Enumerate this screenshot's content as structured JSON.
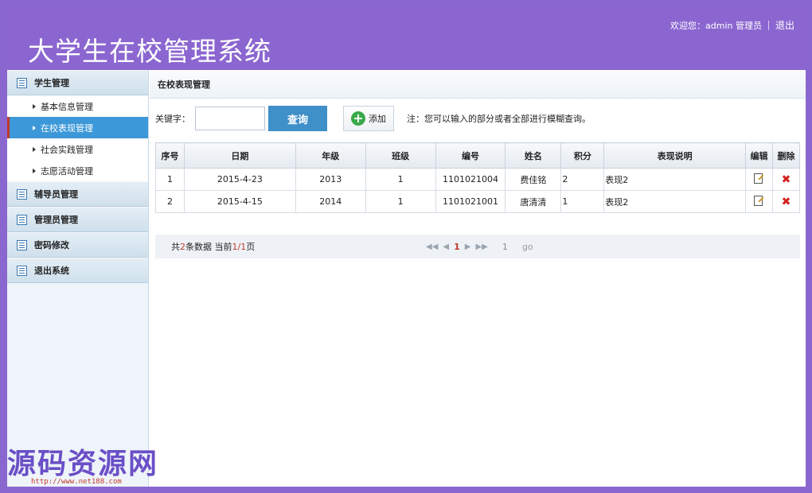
{
  "header": {
    "app_title": "大学生在校管理系统",
    "welcome": "欢迎您：admin 管理员",
    "logout": "退出"
  },
  "sidebar": {
    "groups": [
      {
        "label": "学生管理",
        "items": [
          {
            "label": "基本信息管理"
          },
          {
            "label": "在校表现管理",
            "active": true
          },
          {
            "label": "社会实践管理"
          },
          {
            "label": "志愿活动管理"
          }
        ]
      },
      {
        "label": "辅导员管理"
      },
      {
        "label": "管理员管理"
      },
      {
        "label": "密码修改"
      },
      {
        "label": "退出系统"
      }
    ]
  },
  "main": {
    "breadcrumb": "在校表现管理",
    "search": {
      "label": "关键字：",
      "value": "",
      "query_button": "查询",
      "add_button": "添加",
      "hint": "注：您可以输入的部分或者全部进行模糊查询。"
    },
    "table": {
      "headers": [
        "序号",
        "日期",
        "年级",
        "班级",
        "编号",
        "姓名",
        "积分",
        "表现说明",
        "编辑",
        "删除"
      ],
      "rows": [
        [
          "1",
          "2015-4-23",
          "2013",
          "1",
          "1101021004",
          "费佳铭",
          "2",
          "表现2"
        ],
        [
          "2",
          "2015-4-15",
          "2014",
          "1",
          "1101021001",
          "唐清清",
          "1",
          "表现2"
        ]
      ]
    },
    "pager": {
      "prefix": "共",
      "total": "2",
      "mid": "条数据 当前",
      "current": "1/1",
      "suffix": "页",
      "page": "1",
      "goto_value": "1",
      "go": "go"
    }
  },
  "watermark": {
    "text": "源码资源网",
    "url": "http://www.net188.com"
  }
}
